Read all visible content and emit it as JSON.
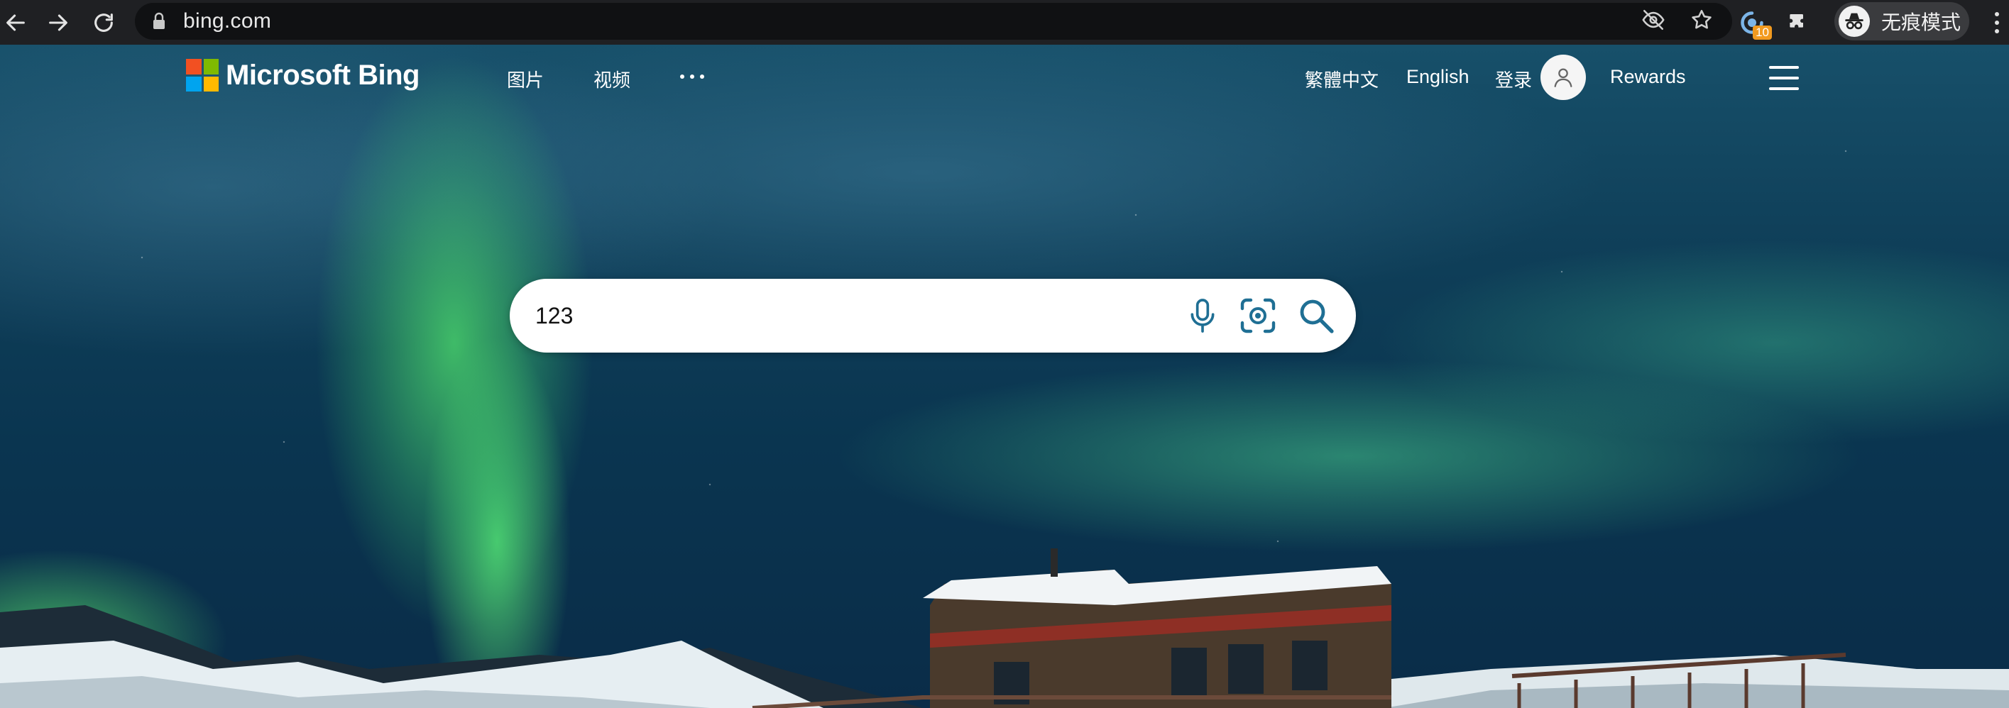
{
  "browser": {
    "url": "bing.com",
    "extension_badge": "10",
    "profile_label": "无痕模式"
  },
  "header": {
    "logo_text": "Microsoft Bing",
    "nav": {
      "images": "图片",
      "videos": "视频"
    },
    "right": {
      "traditional_chinese": "繁體中文",
      "english": "English",
      "sign_in": "登录",
      "rewards": "Rewards"
    }
  },
  "search": {
    "value": "123"
  },
  "colors": {
    "ms_red": "#f25022",
    "ms_green": "#7fba00",
    "ms_blue": "#00a4ef",
    "ms_yellow": "#ffb900",
    "search_icon": "#1f6f94",
    "chrome_bg": "#1f2023"
  },
  "icons": {
    "back": "arrow-left-icon",
    "forward": "arrow-right-icon",
    "reload": "reload-icon",
    "lock": "lock-icon",
    "eye_off": "eye-off-icon",
    "star": "star-icon",
    "extensions": "puzzle-icon",
    "incognito": "incognito-icon",
    "mic": "microphone-icon",
    "visual_search": "visual-search-icon",
    "search": "search-icon",
    "menu": "hamburger-icon",
    "user": "user-icon"
  }
}
